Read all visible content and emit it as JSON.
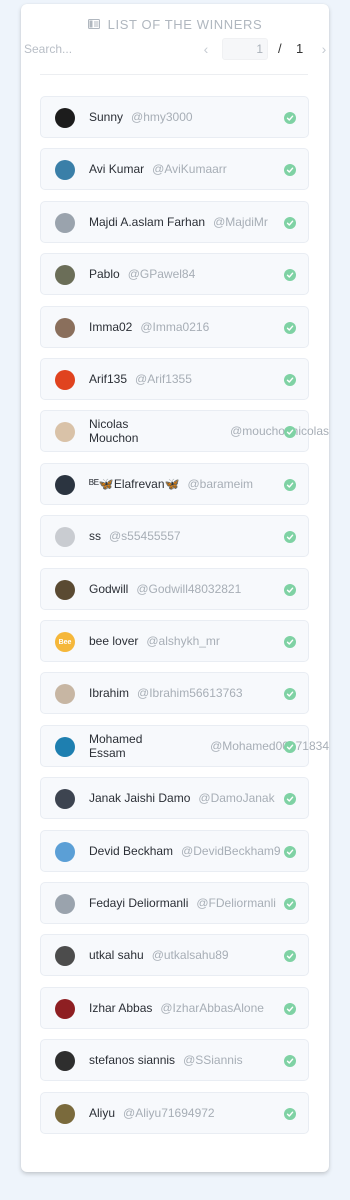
{
  "header": {
    "title": "LIST OF THE WINNERS",
    "icon": "list-icon"
  },
  "search": {
    "placeholder": "Search..."
  },
  "pagination": {
    "current": "1",
    "separator": "/",
    "total": "1",
    "prev_icon": "chevron-left-icon",
    "next_icon": "chevron-right-icon"
  },
  "colors": {
    "check": "#7fd2a4",
    "row_bg": "#f7f9fc",
    "page_bg": "#eef4fb",
    "handle": "#a7aeb6"
  },
  "winners": [
    {
      "name": "Sunny",
      "handle": "@hmy3000",
      "avatar_color": "#1c1c1c",
      "verified": true
    },
    {
      "name": "Avi Kumar",
      "handle": "@AviKumaarr",
      "avatar_color": "#3a7fa8",
      "verified": true
    },
    {
      "name": "Majdi A.aslam Farhan",
      "handle": "@MajdiMr",
      "avatar_color": "#9aa3ad",
      "verified": true
    },
    {
      "name": "Pablo",
      "handle": "@GPawel84",
      "avatar_color": "#6b6e58",
      "verified": true
    },
    {
      "name": "Imma02",
      "handle": "@Imma0216",
      "avatar_color": "#8a6f5c",
      "verified": true
    },
    {
      "name": "Arif135",
      "handle": "@Arif1355",
      "avatar_color": "#e0431f",
      "verified": true
    },
    {
      "name": "Nicolas Mouchon",
      "handle": "@mouchonnicolas",
      "avatar_color": "#d9c2a8",
      "verified": true,
      "two_line": true
    },
    {
      "name": "ᴮᴱ🦋Elafrevan🦋",
      "handle": "@barameim",
      "avatar_color": "#2b3440",
      "verified": true
    },
    {
      "name": "ss",
      "handle": "@s55455557",
      "avatar_color": "#c9ccd1",
      "verified": true
    },
    {
      "name": "Godwill",
      "handle": "@Godwill48032821",
      "avatar_color": "#5a4a32",
      "verified": true
    },
    {
      "name": "bee lover",
      "handle": "@alshykh_mr",
      "avatar_color": "#f5b73a",
      "avatar_text": "Bee",
      "verified": true
    },
    {
      "name": "Ibrahim",
      "handle": "@Ibrahim56613763",
      "avatar_color": "#c7b6a3",
      "verified": true
    },
    {
      "name": "Mohamed Essam",
      "handle": "@Mohamed00171834",
      "avatar_color": "#1e7fb0",
      "verified": true,
      "two_line": true
    },
    {
      "name": "Janak Jaishi Damo",
      "handle": "@DamoJanak",
      "avatar_color": "#3d4450",
      "verified": true
    },
    {
      "name": "Devid Beckham",
      "handle": "@DevidBeckham9",
      "avatar_color": "#5b9fd6",
      "verified": true
    },
    {
      "name": "Fedayi Deliormanli",
      "handle": "@FDeliormanli",
      "avatar_color": "#9aa3ad",
      "verified": true
    },
    {
      "name": "utkal sahu",
      "handle": "@utkalsahu89",
      "avatar_color": "#4c4c4c",
      "verified": true
    },
    {
      "name": "Izhar Abbas",
      "handle": "@IzharAbbasAlone",
      "avatar_color": "#8e1f22",
      "verified": true
    },
    {
      "name": "stefanos siannis",
      "handle": "@SSiannis",
      "avatar_color": "#2e2e2e",
      "verified": true
    },
    {
      "name": "Aliyu",
      "handle": "@Aliyu71694972",
      "avatar_color": "#7a6a3c",
      "verified": true
    }
  ]
}
